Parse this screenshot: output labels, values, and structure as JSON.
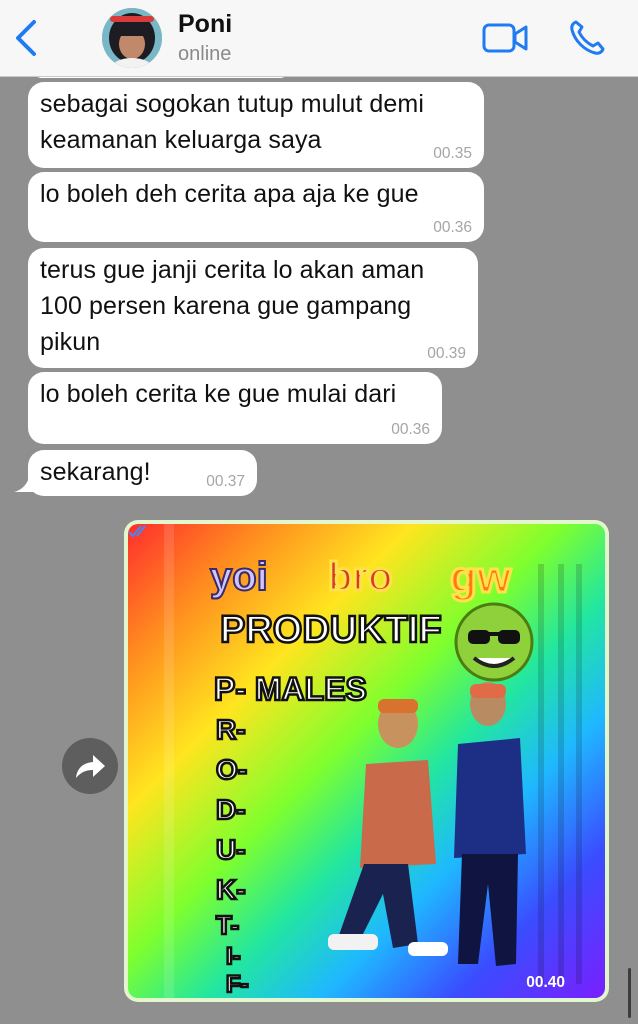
{
  "header": {
    "contact_name": "Poni",
    "status": "online",
    "back_icon": "chevron-left-icon",
    "video_icon": "video-camera-icon",
    "call_icon": "phone-icon",
    "accent_color": "#1f7bf2"
  },
  "messages": [
    {
      "direction": "in",
      "text": "sebagai sogokan tutup mulut demi\nkeamanan keluarga saya",
      "time": "00.35"
    },
    {
      "direction": "in",
      "text": "lo boleh deh cerita apa aja ke gue",
      "time": "00.36"
    },
    {
      "direction": "in",
      "text": "terus gue janji cerita lo akan aman\n100 persen karena gue gampang\npikun",
      "time": "00.39"
    },
    {
      "direction": "in",
      "text": "lo boleh cerita ke gue mulai dari",
      "time": "00.36"
    },
    {
      "direction": "in",
      "text": "sekarang!",
      "time": "00.37"
    },
    {
      "direction": "out",
      "type": "image",
      "time": "00.40",
      "status_icon": "double-check-icon",
      "image_text": {
        "line1": [
          "yoi",
          "bro",
          "gw"
        ],
        "line2": "PRODUKTIF",
        "line3": "P- MALES",
        "letters": [
          "R-",
          "O-",
          "D-",
          "U-",
          "K-",
          "T-",
          "I-",
          "F-"
        ]
      }
    }
  ],
  "forward_icon": "forward-arrow-icon"
}
